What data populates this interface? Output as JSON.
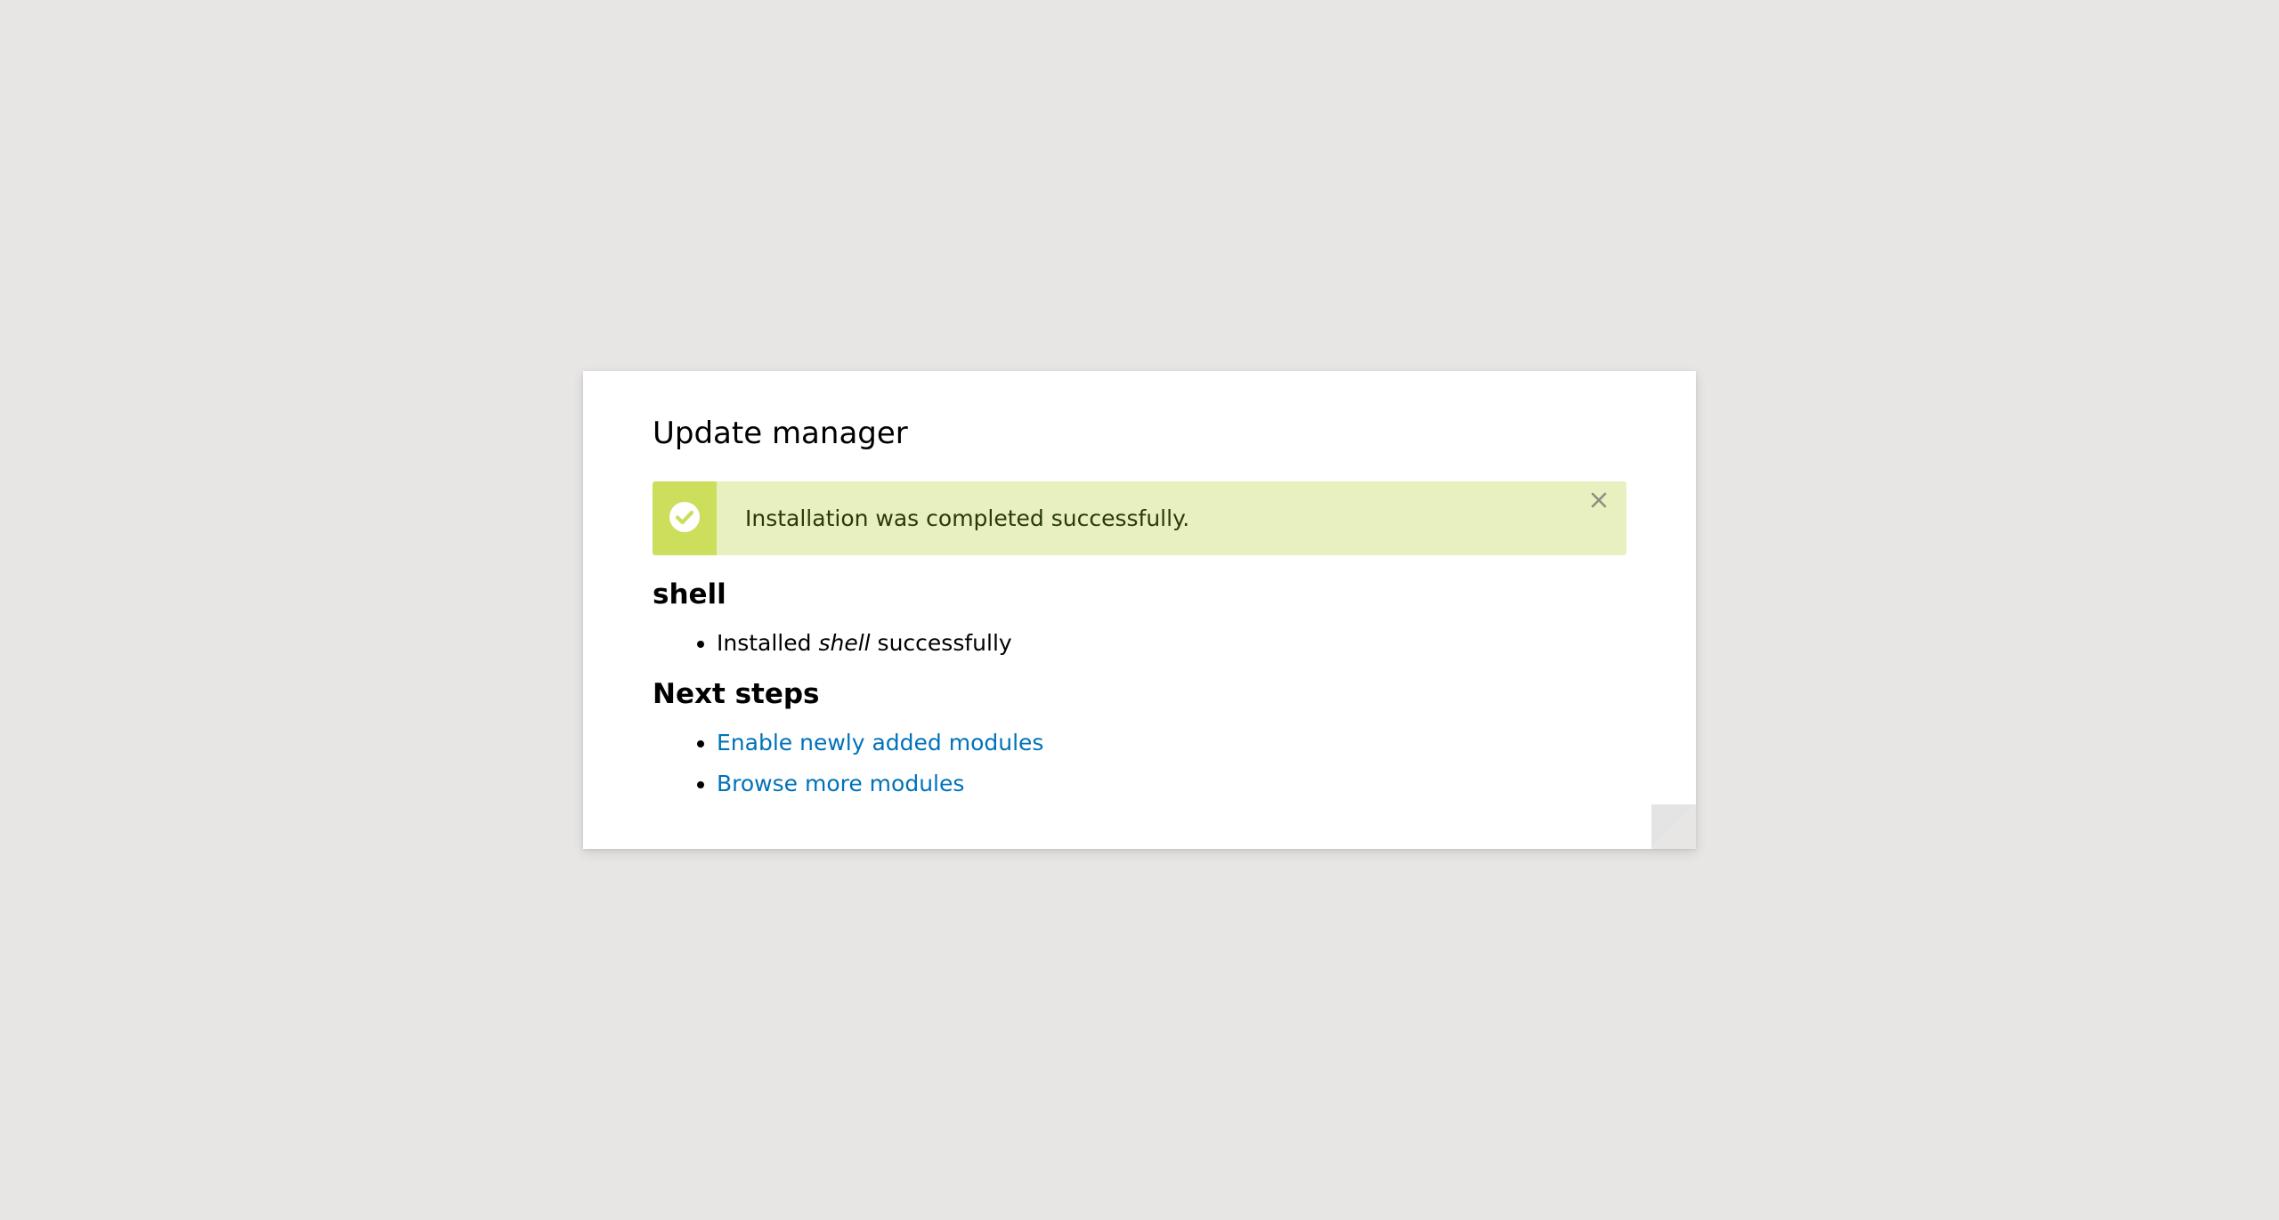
{
  "page": {
    "title": "Update manager"
  },
  "message": {
    "status": "success",
    "text": "Installation was completed successfully.",
    "icon": "check-circle-icon",
    "close_icon": "close-icon",
    "colors": {
      "background": "#e8f0bf",
      "stripe": "#cddd5c",
      "text": "#2b3a0a"
    }
  },
  "project": {
    "name": "shell",
    "result": {
      "prefix": "Installed ",
      "name": "shell",
      "suffix": " successfully"
    }
  },
  "next_steps": {
    "title": "Next steps",
    "links": [
      {
        "label": "Enable newly added modules"
      },
      {
        "label": "Browse more modules"
      }
    ],
    "link_color": "#0072b9"
  }
}
